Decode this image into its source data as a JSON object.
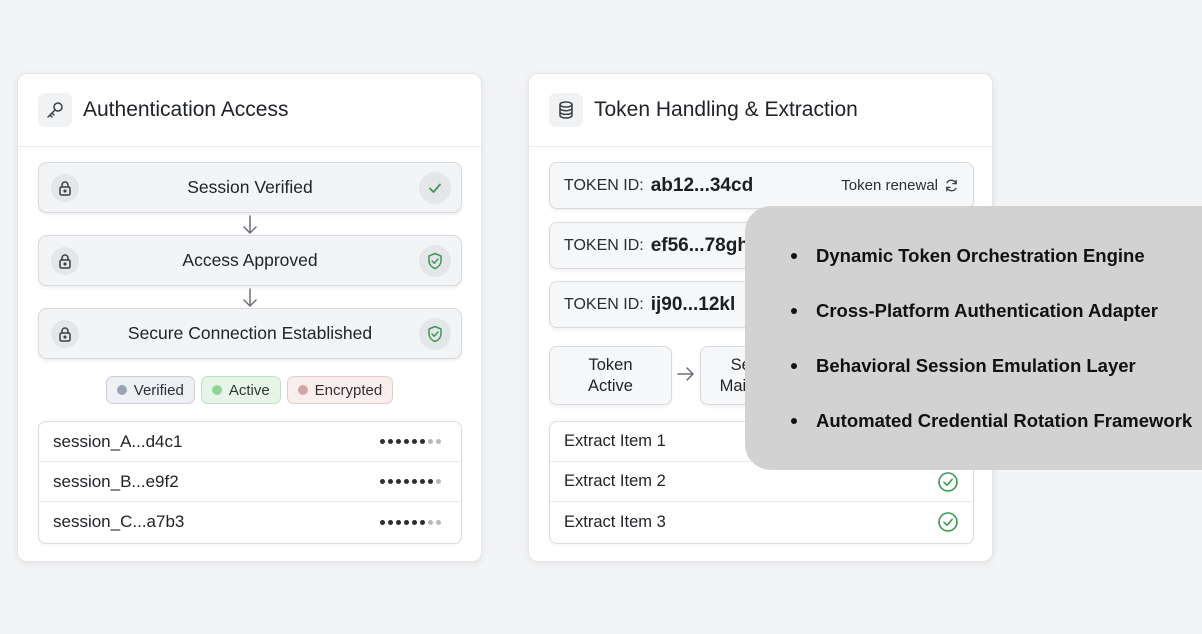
{
  "auth_panel": {
    "title": "Authentication Access",
    "steps": [
      {
        "label": "Session Verified",
        "status": "check"
      },
      {
        "label": "Access Approved",
        "status": "shield-check"
      },
      {
        "label": "Secure Connection Established",
        "status": "shield-check"
      }
    ],
    "badges": [
      {
        "label": "Verified",
        "color": "#9aa3b4"
      },
      {
        "label": "Active",
        "color": "#8fd49b"
      },
      {
        "label": "Encrypted",
        "color": "#d2a6a6"
      }
    ],
    "sessions": [
      {
        "name": "session_A...d4c1"
      },
      {
        "name": "session_B...e9f2"
      },
      {
        "name": "session_C...a7b3"
      }
    ]
  },
  "token_panel": {
    "title": "Token Handling & Extraction",
    "token_prefix": "TOKEN ID:",
    "tokens": [
      {
        "id": "ab12...34cd"
      },
      {
        "id": "ef56...78gh"
      },
      {
        "id": "ij90...12kl"
      }
    ],
    "renewal_label": "Token renewal",
    "flow": {
      "box1": "Token Active",
      "box2": "Session Maintained"
    },
    "extract_items": [
      {
        "label": "Extract Item 1"
      },
      {
        "label": "Extract Item 2"
      },
      {
        "label": "Extract Item 3"
      }
    ]
  },
  "overlay": {
    "items": [
      "Dynamic Token Orchestration Engine",
      "Cross-Platform Authentication Adapter",
      "Behavioral Session Emulation Layer",
      "Automated Credential Rotation Framework"
    ]
  }
}
